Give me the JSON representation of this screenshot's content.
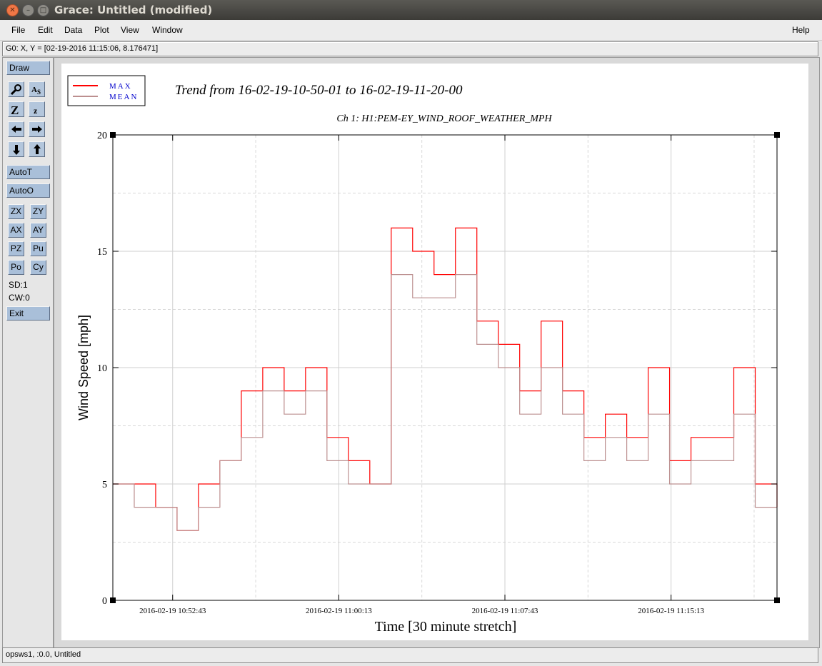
{
  "window": {
    "title": "Grace: Untitled (modified)"
  },
  "menu": {
    "items": [
      "File",
      "Edit",
      "Data",
      "Plot",
      "View",
      "Window"
    ],
    "help": "Help"
  },
  "coord_readout": "G0: X, Y = [02-19-2016 11:15:06, 8.176471]",
  "toolbar": {
    "draw": "Draw",
    "autot": "AutoT",
    "autoo": "AutoO",
    "zx": "ZX",
    "zy": "ZY",
    "ax": "AX",
    "ay": "AY",
    "pz": "PZ",
    "pu": "Pu",
    "po": "Po",
    "cy": "Cy",
    "sd": "SD:1",
    "cw": "CW:0",
    "exit": "Exit"
  },
  "status": "opsws1, :0.0, Untitled",
  "colors": {
    "max": "#ff0000",
    "mean": "#bc8f8f"
  },
  "chart_data": {
    "type": "line",
    "title": "Trend from 16-02-19-10-50-01 to 16-02-19-11-20-00",
    "subtitle": "Ch 1: H1:PEM-EY_WIND_ROOF_WEATHER_MPH",
    "xlabel": "Time [30 minute stretch]",
    "ylabel": "Wind Speed [mph]",
    "xlim": [
      "2016-02-19 10:50:01",
      "2016-02-19 11:20:00"
    ],
    "ylim": [
      0,
      20
    ],
    "yticks": [
      "0",
      "5",
      "10",
      "15",
      "20"
    ],
    "xticks": [
      "2016-02-19 10:52:43",
      "2016-02-19 11:00:13",
      "2016-02-19 11:07:43",
      "2016-02-19 11:15:13"
    ],
    "grid": true,
    "legend_position": "top-left",
    "x": [
      "10:50:01",
      "10:50:59",
      "10:51:57",
      "10:52:55",
      "10:53:53",
      "10:54:51",
      "10:55:49",
      "10:56:47",
      "10:57:45",
      "10:58:43",
      "10:59:41",
      "11:00:39",
      "11:01:37",
      "11:02:35",
      "11:03:33",
      "11:04:31",
      "11:05:29",
      "11:06:27",
      "11:07:25",
      "11:08:23",
      "11:09:21",
      "11:10:19",
      "11:11:17",
      "11:12:15",
      "11:13:13",
      "11:14:11",
      "11:15:09",
      "11:16:07",
      "11:17:05",
      "11:18:03",
      "11:19:01",
      "11:20:00"
    ],
    "series": [
      {
        "name": "MAX",
        "values": [
          5,
          5,
          4,
          3,
          5,
          6,
          9,
          10,
          9,
          10,
          7,
          6,
          5,
          16,
          15,
          14,
          16,
          12,
          11,
          9,
          12,
          9,
          7,
          8,
          7,
          10,
          6,
          7,
          7,
          10,
          5,
          4
        ]
      },
      {
        "name": "MEAN",
        "values": [
          5,
          4,
          4,
          3,
          4,
          6,
          7,
          9,
          8,
          9,
          6,
          5,
          5,
          14,
          13,
          13,
          14,
          11,
          10,
          8,
          10,
          8,
          6,
          7,
          6,
          8,
          5,
          6,
          6,
          8,
          4,
          4
        ]
      }
    ]
  }
}
